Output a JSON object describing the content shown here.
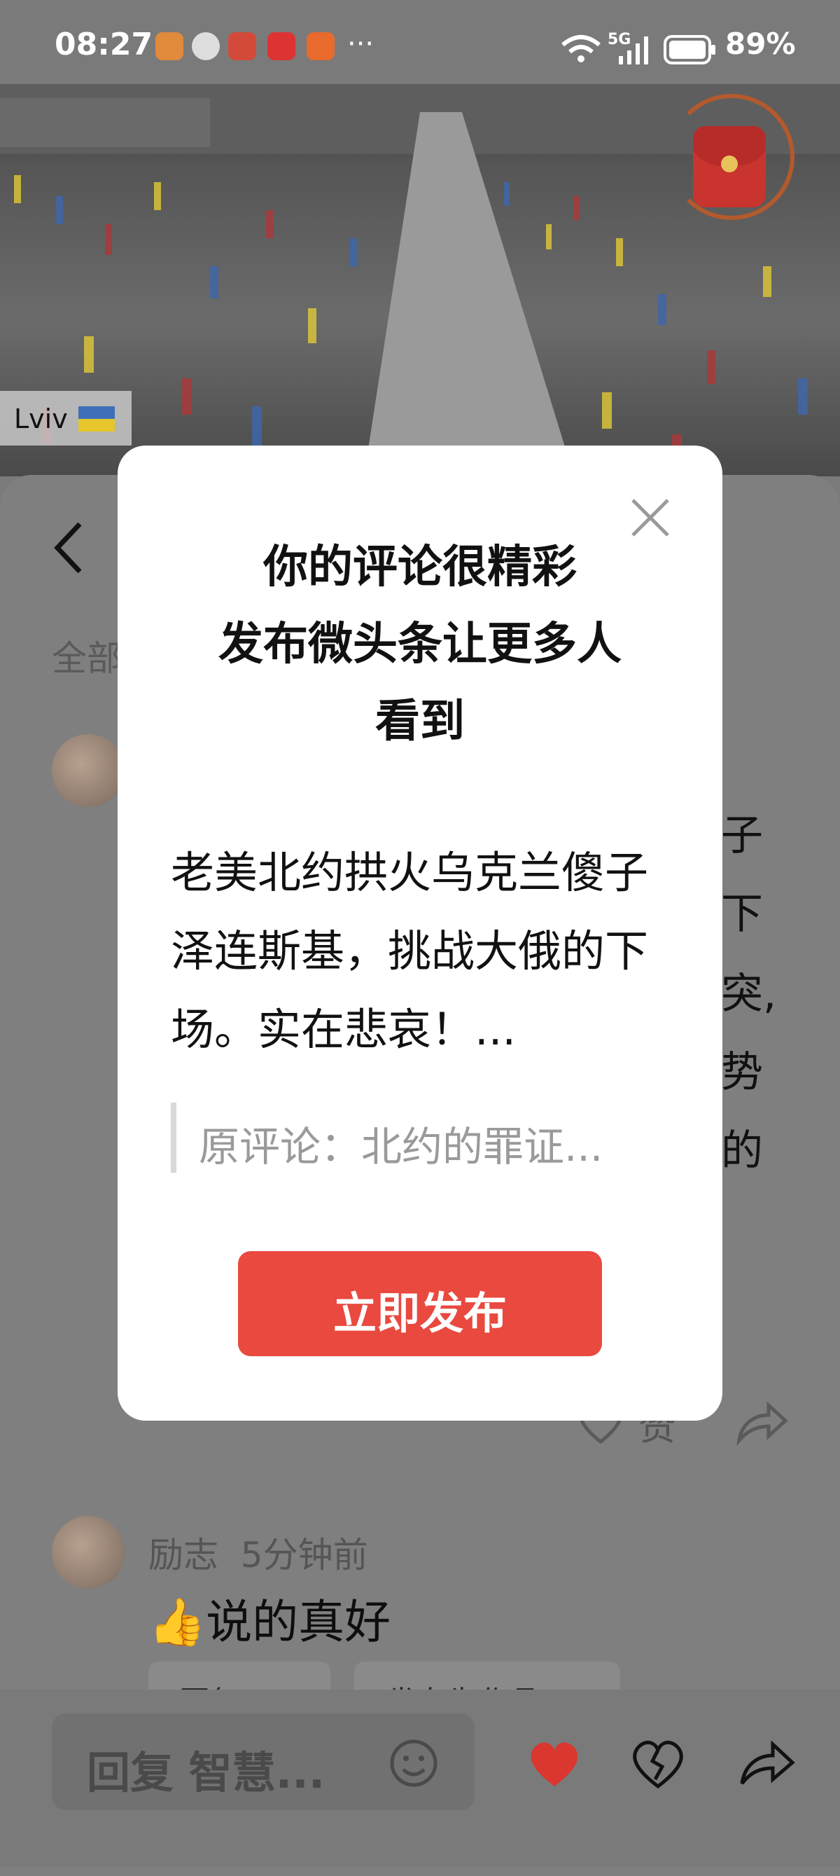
{
  "status_bar": {
    "time": "08:27",
    "more": "···",
    "network": "5G",
    "battery": "89%"
  },
  "video": {
    "location_label": "Lviv"
  },
  "sheet": {
    "tab_all_partial": "全部",
    "right_partials": [
      "子",
      "下",
      "突,",
      "势",
      "的"
    ],
    "like_label_partial": "赞",
    "comment": {
      "author": "励志",
      "time": "5分钟前",
      "emoji": "👍",
      "text": "说的真好"
    },
    "action_pills": [
      "回复 ›",
      "发布为作品"
    ],
    "reply_placeholder": "回复 智慧..."
  },
  "modal": {
    "title_line1": "你的评论很精彩",
    "title_line2": "发布微头条让更多人",
    "title_line3": "看到",
    "body": "老美北约拱火乌克兰傻子泽连斯基，挑战大俄的下场。实在悲哀！...",
    "quote": "原评论：北约的罪证...",
    "publish_label": "立即发布"
  },
  "colors": {
    "accent": "#e9493f",
    "like_red": "#d9372f",
    "dim_overlay": "#7a7a7a"
  }
}
